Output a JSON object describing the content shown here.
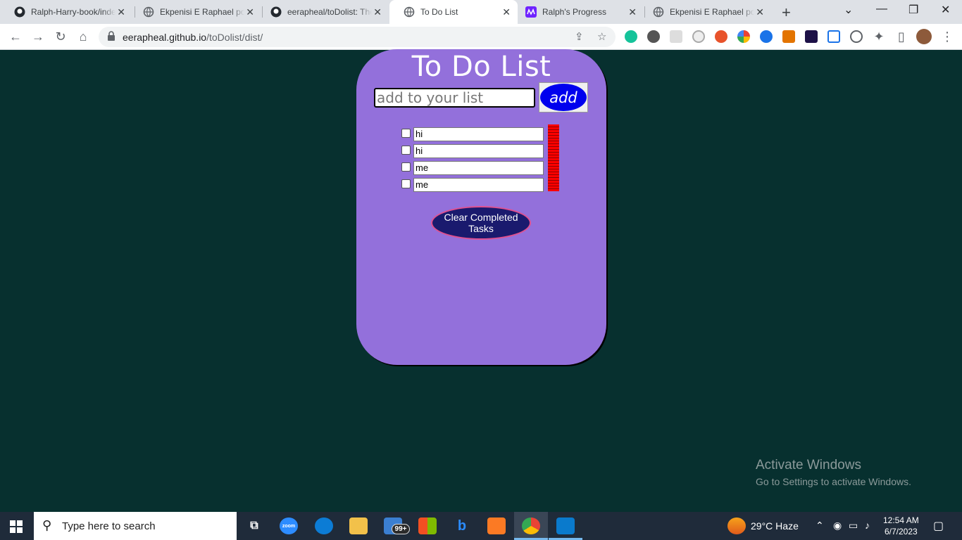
{
  "browser": {
    "tabs": [
      {
        "title": "Ralph-Harry-book/index",
        "icon": "github-icon",
        "active": false
      },
      {
        "title": "Ekpenisi E Raphael portfolio",
        "icon": "globe-icon",
        "active": false
      },
      {
        "title": "eerapheal/toDolist: The",
        "icon": "github-icon",
        "active": false
      },
      {
        "title": "To Do List",
        "icon": "globe-icon",
        "active": true
      },
      {
        "title": "Ralph's Progress",
        "icon": "microverse-icon",
        "active": false
      },
      {
        "title": "Ekpenisi E Raphael portfolio",
        "icon": "globe-icon",
        "active": false
      }
    ],
    "url_host": "eerapheal.github.io",
    "url_path": "/toDolist/dist/"
  },
  "app": {
    "title": "To Do List",
    "input_placeholder": "add to your list",
    "add_label": "add",
    "tasks": [
      {
        "text": "hi",
        "completed": false
      },
      {
        "text": "hi",
        "completed": false
      },
      {
        "text": "me",
        "completed": false
      },
      {
        "text": "me",
        "completed": false
      }
    ],
    "clear_label": "Clear Completed Tasks",
    "colors": {
      "card": "#9370db",
      "background": "#07302f",
      "add_button": "#0000ee",
      "clear_button": "#1a1a6e",
      "delete": "#ff0000"
    }
  },
  "watermark": {
    "line1": "Activate Windows",
    "line2": "Go to Settings to activate Windows."
  },
  "taskbar": {
    "search_placeholder": "Type here to search",
    "mail_badge": "99+",
    "weather": "29°C  Haze",
    "time": "12:54 AM",
    "date": "6/7/2023"
  }
}
